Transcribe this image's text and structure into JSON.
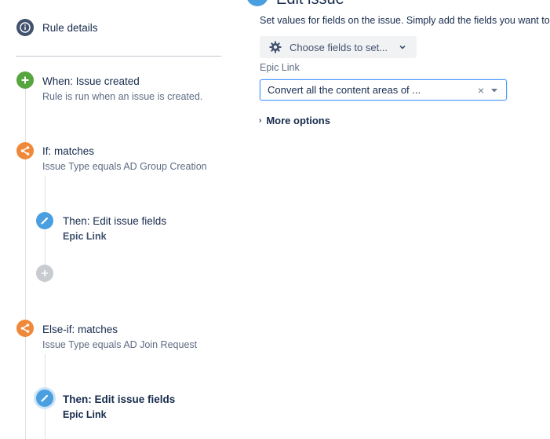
{
  "rule_details": {
    "label": "Rule details",
    "icon": "info-icon"
  },
  "trigger": {
    "title": "When: Issue created",
    "subtitle": "Rule is run when an issue is created.",
    "icon": "plus-icon",
    "color": "#57a53f"
  },
  "condition_if": {
    "title": "If: matches",
    "subtitle": "Issue Type equals AD Group Creation",
    "icon": "branch-icon",
    "color": "#f0883a"
  },
  "action_1": {
    "title": "Then: Edit issue fields",
    "subtitle": "Epic Link",
    "icon": "pencil-icon",
    "color": "#4a9fe0"
  },
  "add_component": {
    "icon": "plus-icon",
    "color": "#c8cbd0"
  },
  "condition_else_if": {
    "title": "Else-if: matches",
    "subtitle": "Issue Type equals AD Join Request",
    "icon": "branch-icon",
    "color": "#f0883a"
  },
  "action_2": {
    "title": "Then: Edit issue fields",
    "subtitle": "Epic Link",
    "icon": "pencil-icon",
    "color": "#4a9fe0",
    "selected": true
  },
  "panel": {
    "heading": "Edit issue",
    "description": "Set values for fields on the issue. Simply add the fields you want to",
    "choose_fields_label": "Choose fields to set...",
    "field_label": "Epic Link",
    "field_value": "Convert all the content areas of ...",
    "clear_symbol": "×",
    "more_options_label": "More options",
    "more_options_arrow": "›"
  }
}
